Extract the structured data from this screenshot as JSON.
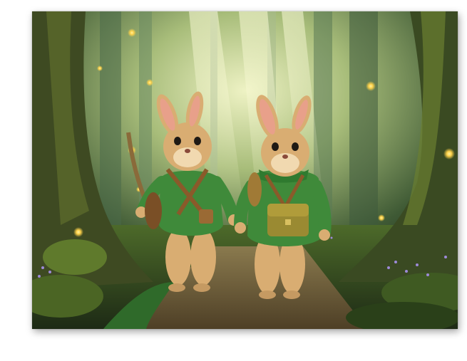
{
  "artwork": {
    "subject": "",
    "palette": {
      "forest_dark": "#1f2a1a",
      "forest_light": "#c9d8a0",
      "moss": "#5f7a2c",
      "path": "#7a6a45",
      "fur": "#d9ad72",
      "jacket": "#3f8a3a",
      "strap": "#8a5a2a",
      "firefly": "#ffd24a",
      "flowers": "#9d8ad8"
    }
  }
}
